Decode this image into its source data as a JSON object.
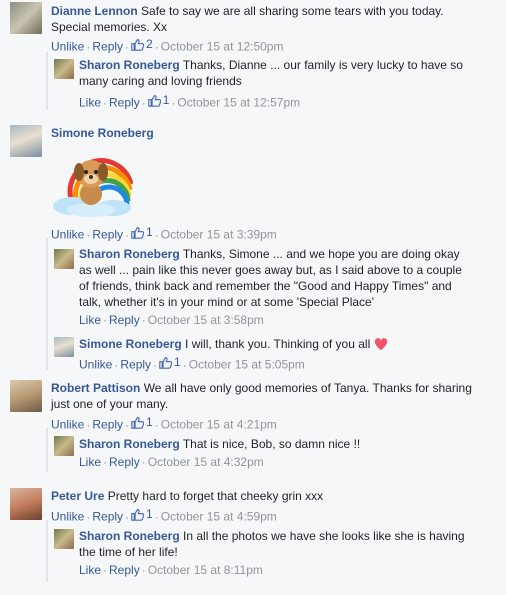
{
  "comments": [
    {
      "author": "Dianne Lennon",
      "text1": "Safe to say we are all sharing some tears with you today.",
      "text2": "Special memories. Xx",
      "unlike": "Unlike",
      "reply": "Reply",
      "likes": "2",
      "time": "October 15 at 12:50pm"
    },
    {
      "author": "Sharon Roneberg",
      "text1": "Thanks, Dianne ... our family is very lucky to have so",
      "text2": "many caring and loving friends",
      "like": "Like",
      "reply": "Reply",
      "likes": "1",
      "time": "October 15 at 12:57pm"
    },
    {
      "author": "Simone Roneberg",
      "unlike": "Unlike",
      "reply": "Reply",
      "likes": "1",
      "time": "October 15 at 3:39pm"
    },
    {
      "author": "Sharon Roneberg",
      "text1": "Thanks, Simone ... and we hope you are doing okay",
      "text2": "as well ... pain like this never goes away but, as I said above to a couple",
      "text3": "of friends, think back and remember the \"Good and Happy Times\" and",
      "text4": "talk, whether it's in your mind or at some 'Special Place'",
      "like": "Like",
      "reply": "Reply",
      "time": "October 15 at 3:58pm"
    },
    {
      "author": "Simone Roneberg",
      "text1": "I will, thank you. Thinking of you all",
      "unlike": "Unlike",
      "reply": "Reply",
      "likes": "1",
      "time": "October 15 at 5:05pm"
    },
    {
      "author": "Robert Pattison",
      "text1": "We all have only good memories of Tanya. Thanks for sharing",
      "text2": "just one of your many.",
      "unlike": "Unlike",
      "reply": "Reply",
      "likes": "1",
      "time": "October 15 at 4:21pm"
    },
    {
      "author": "Sharon Roneberg",
      "text1": "That is nice, Bob, so damn nice !!",
      "like": "Like",
      "reply": "Reply",
      "time": "October 15 at 4:32pm"
    },
    {
      "author": "Peter Ure",
      "text1": "Pretty hard to forget that cheeky grin xxx",
      "unlike": "Unlike",
      "reply": "Reply",
      "likes": "1",
      "time": "October 15 at 4:59pm"
    },
    {
      "author": "Sharon Roneberg",
      "text1": "In all the photos we have she looks like she is having",
      "text2": "the time of her life!",
      "like": "Like",
      "reply": "Reply",
      "time": "October 15 at 8:11pm"
    }
  ],
  "colors": {
    "link": "#365899",
    "meta": "#90949c",
    "bg": "#f6f7f9"
  },
  "icons": [
    "thumbs-up-icon",
    "heart-icon",
    "rainbow-dog-sticker"
  ]
}
